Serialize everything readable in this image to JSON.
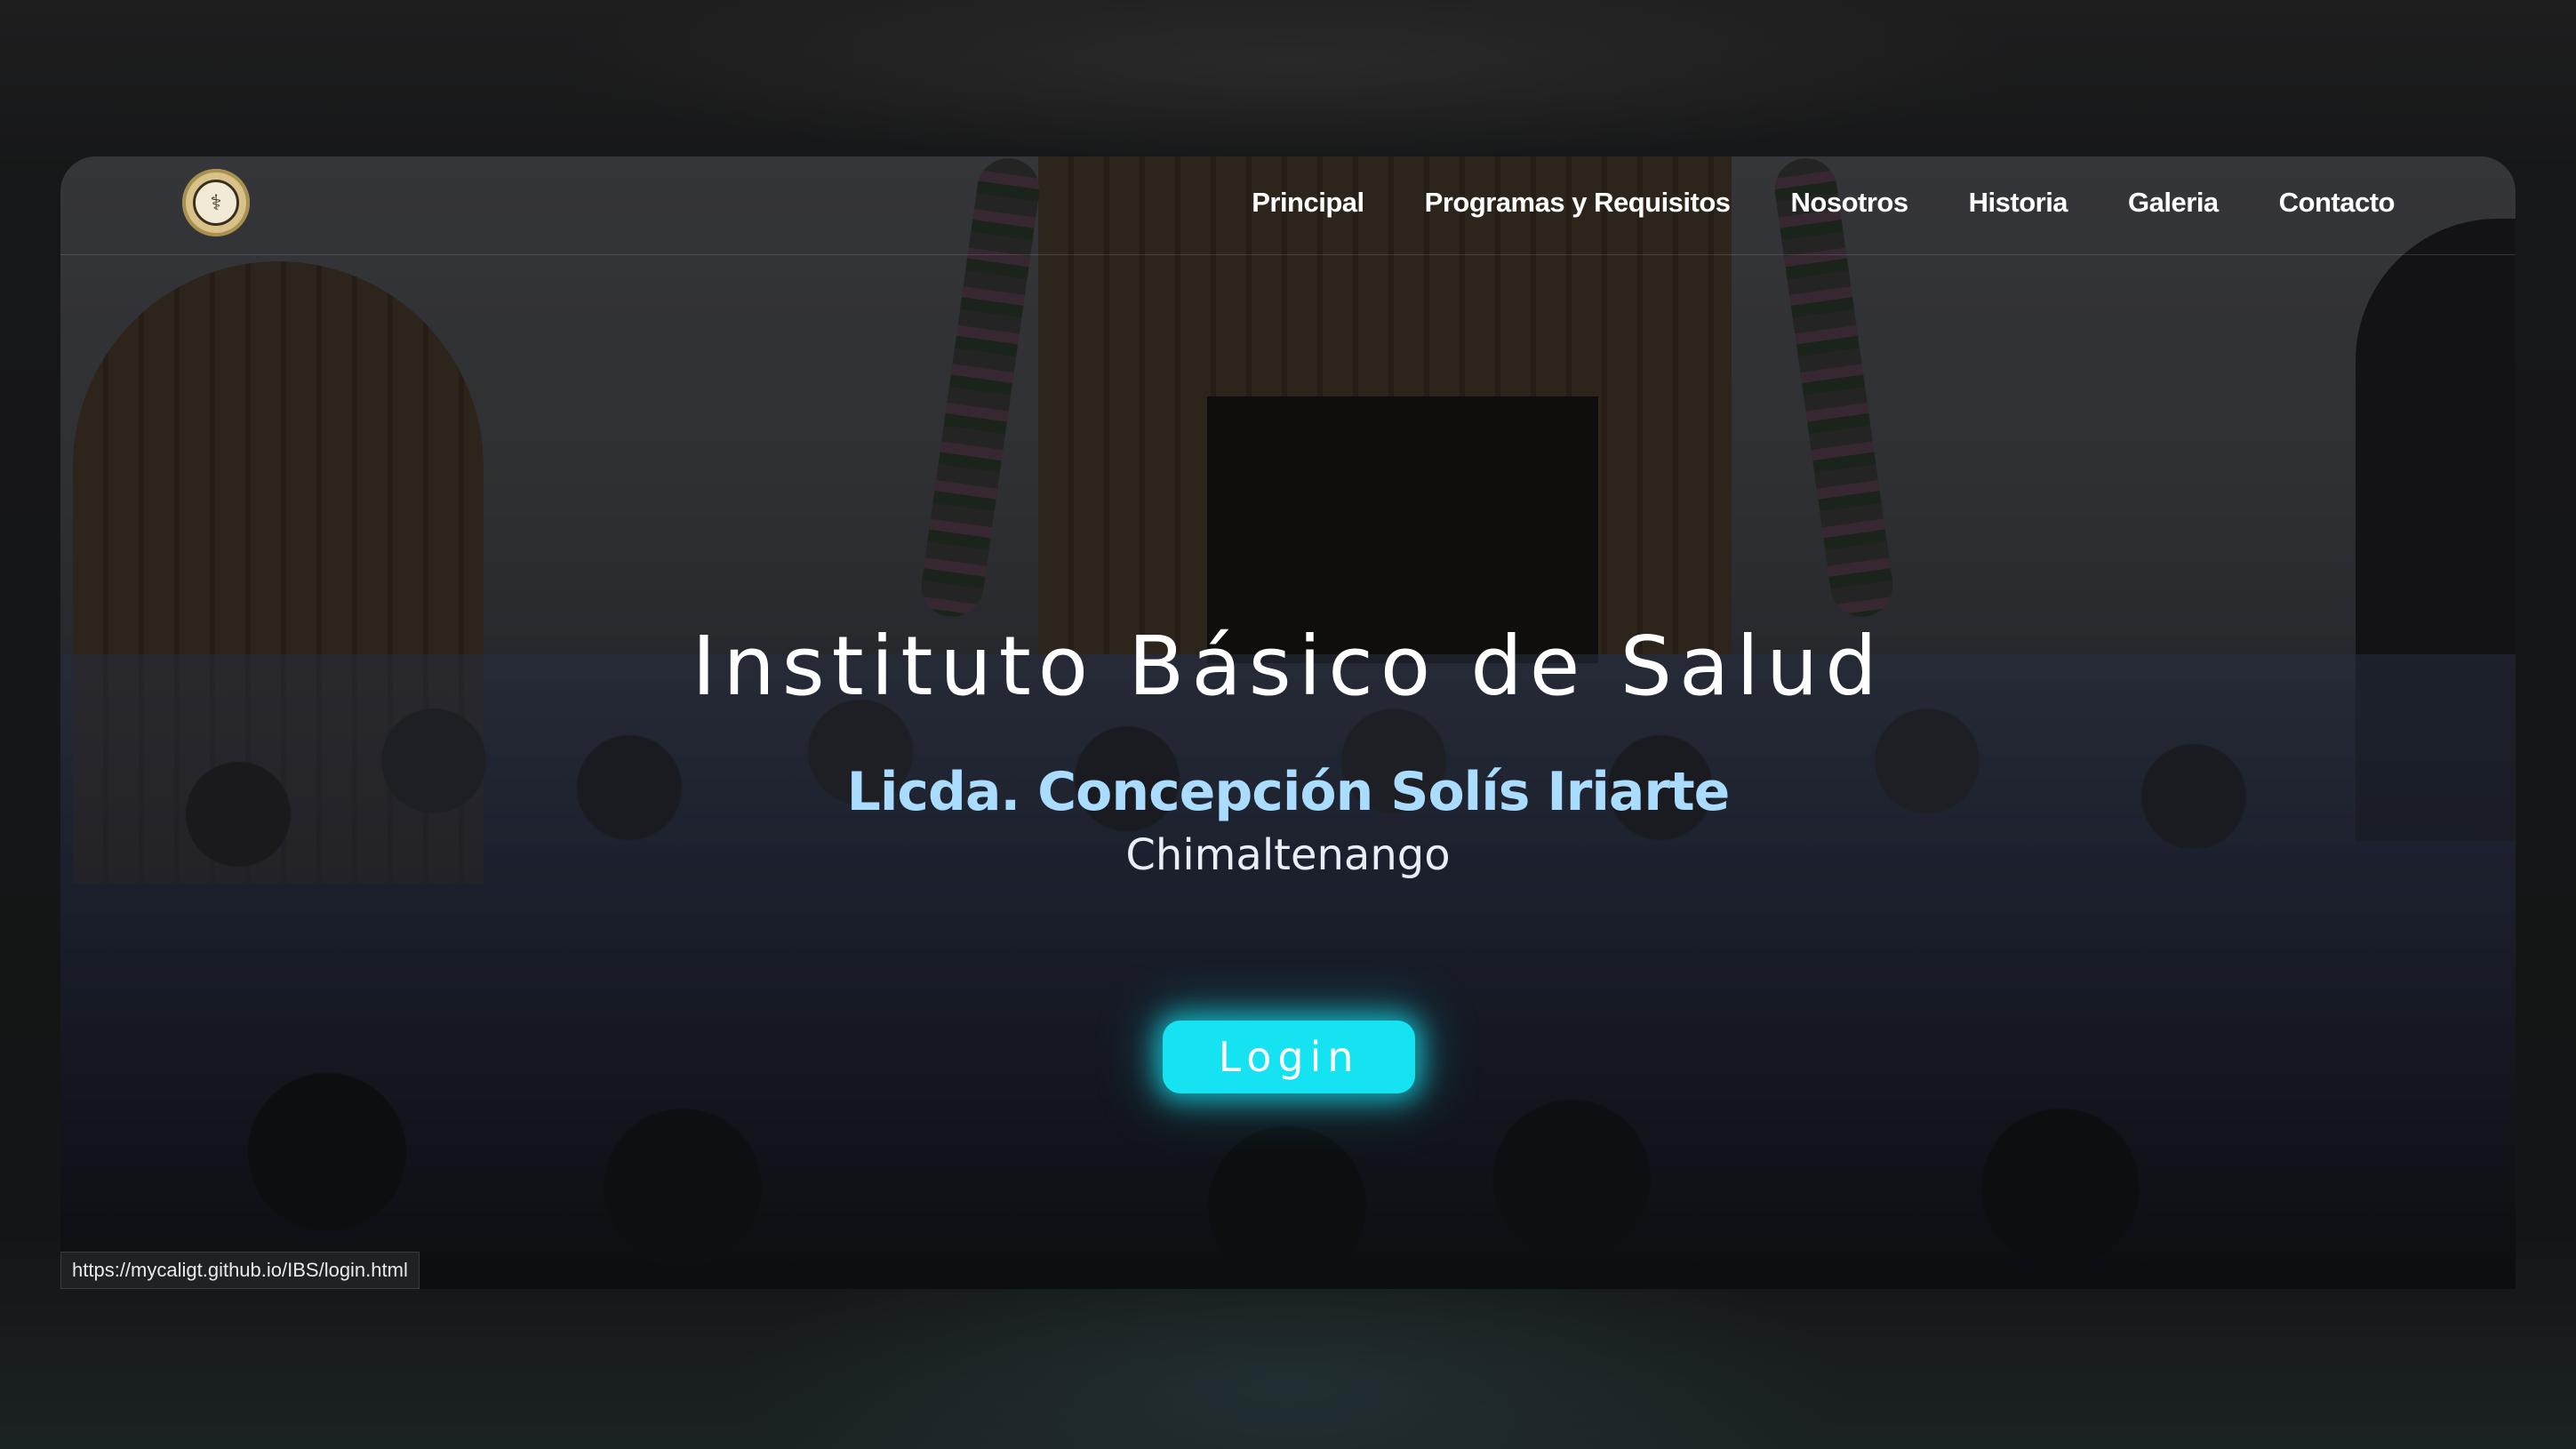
{
  "nav": {
    "logo_icon": "institute-seal-icon",
    "items": [
      {
        "label": "Principal"
      },
      {
        "label": "Programas y Requisitos"
      },
      {
        "label": "Nosotros"
      },
      {
        "label": "Historia"
      },
      {
        "label": "Galeria"
      },
      {
        "label": "Contacto"
      }
    ]
  },
  "hero": {
    "title": "Instituto Básico de Salud",
    "subtitle": "Licda. Concepción Solís Iriarte",
    "city": "Chimaltenango",
    "login_label": "Login"
  },
  "status_bar": {
    "url": "https://mycaligt.github.io/IBS/login.html"
  },
  "colors": {
    "accent": "#16e3f2",
    "subtitle": "#a9dcff",
    "nav_text": "#ffffff"
  }
}
